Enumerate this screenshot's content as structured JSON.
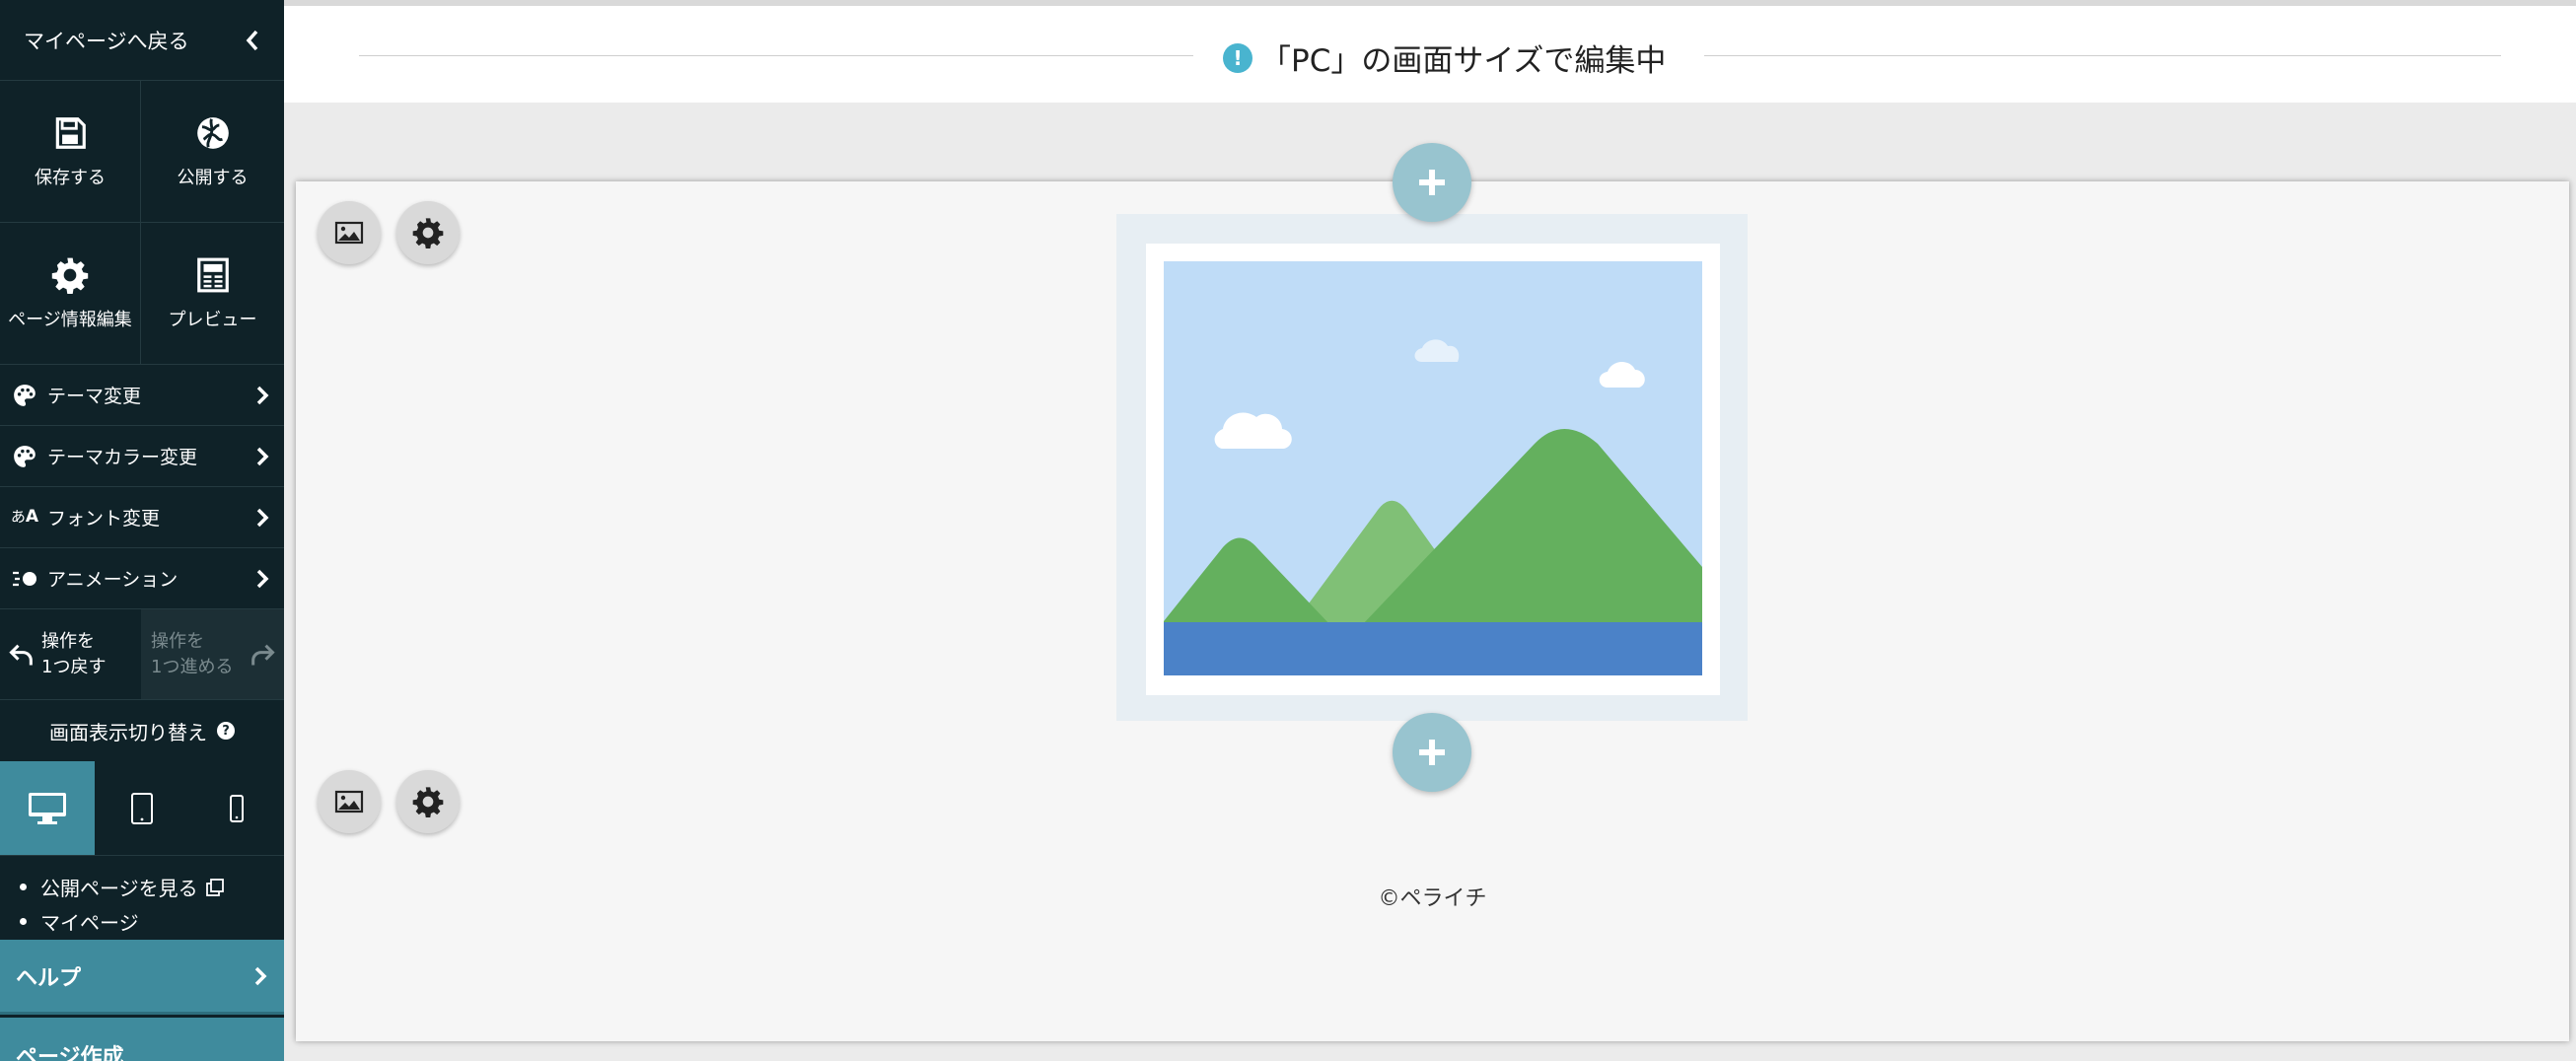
{
  "sidebar": {
    "back_label": "マイページへ戻る",
    "tiles": [
      {
        "label": "保存する",
        "icon": "save-icon"
      },
      {
        "label": "公開する",
        "icon": "globe-icon"
      },
      {
        "label": "ページ情報編集",
        "icon": "gear-icon"
      },
      {
        "label": "プレビュー",
        "icon": "preview-icon"
      }
    ],
    "menu": [
      {
        "label": "テーマ変更",
        "icon": "palette-icon"
      },
      {
        "label": "テーマカラー変更",
        "icon": "palette-icon"
      },
      {
        "label": "フォント変更",
        "icon": "font-icon"
      },
      {
        "label": "アニメーション",
        "icon": "animation-icon"
      }
    ],
    "undo_label_1": "操作を",
    "undo_label_2": "1つ戻す",
    "redo_label_1": "操作を",
    "redo_label_2": "1つ進める",
    "display_switch_label": "画面表示切り替え",
    "devices": [
      "pc",
      "tablet",
      "smartphone"
    ],
    "active_device": "pc",
    "links": [
      "公開ページを見る",
      "マイページ"
    ],
    "help_label": "ヘルプ",
    "create_label": "ページ作成"
  },
  "topbar": {
    "message": "「PC」の画面サイズで編集中",
    "alert_glyph": "!"
  },
  "canvas": {
    "footer_text": "©ペライチ"
  },
  "colors": {
    "sidebar_bg": "#0f2228",
    "accent": "#3f8b9d",
    "add_button": "#98c4cf",
    "alert": "#49b4cf"
  }
}
